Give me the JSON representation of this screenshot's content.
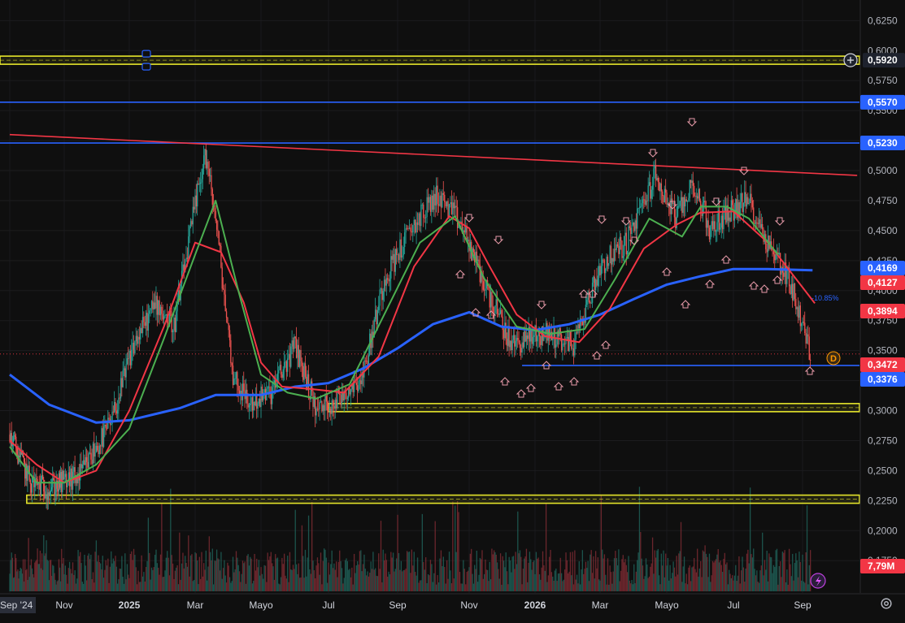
{
  "chart_data": {
    "type": "candlestick",
    "y_axis": {
      "ylim": [
        0.165,
        0.632
      ],
      "ticks": [
        "0,6250",
        "0,6000",
        "0,5750",
        "0,5500",
        "0,5250",
        "0,5000",
        "0,4750",
        "0,4500",
        "0,4250",
        "0,4000",
        "0,3750",
        "0,3500",
        "0,3250",
        "0,3000",
        "0,2750",
        "0,2500",
        "0,2250",
        "0,2000",
        "0,1750"
      ],
      "tick_values": [
        0.625,
        0.6,
        0.575,
        0.55,
        0.525,
        0.5,
        0.475,
        0.45,
        0.425,
        0.4,
        0.375,
        0.35,
        0.325,
        0.3,
        0.275,
        0.25,
        0.225,
        0.2,
        0.175
      ]
    },
    "x_axis": {
      "labels": [
        "Sep '24",
        "Nov",
        "2025",
        "Mar",
        "Mayo",
        "Jul",
        "Sep",
        "Nov",
        "2026",
        "Mar",
        "Mayo",
        "Jul",
        "Sep"
      ],
      "label_dates": [
        "2024-09-01",
        "2024-11-01",
        "2025-01-01",
        "2025-03-01",
        "2025-05-01",
        "2025-07-01",
        "2025-09-01",
        "2025-11-01",
        "2026-01-01",
        "2026-03-01",
        "2026-05-01",
        "2026-07-01",
        "2026-09-01"
      ]
    },
    "price_path": [
      [
        "2024-09-01",
        0.28
      ],
      [
        "2024-09-25",
        0.24
      ],
      [
        "2024-10-15",
        0.235
      ],
      [
        "2024-11-15",
        0.245
      ],
      [
        "2024-12-15",
        0.29
      ],
      [
        "2025-01-05",
        0.355
      ],
      [
        "2025-01-25",
        0.39
      ],
      [
        "2025-02-10",
        0.37
      ],
      [
        "2025-02-25",
        0.45
      ],
      [
        "2025-03-10",
        0.515
      ],
      [
        "2025-03-20",
        0.46
      ],
      [
        "2025-04-05",
        0.33
      ],
      [
        "2025-04-20",
        0.305
      ],
      [
        "2025-05-10",
        0.315
      ],
      [
        "2025-06-01",
        0.355
      ],
      [
        "2025-06-20",
        0.3
      ],
      [
        "2025-07-10",
        0.31
      ],
      [
        "2025-08-01",
        0.33
      ],
      [
        "2025-08-20",
        0.41
      ],
      [
        "2025-09-15",
        0.455
      ],
      [
        "2025-10-05",
        0.48
      ],
      [
        "2025-10-25",
        0.455
      ],
      [
        "2025-11-15",
        0.405
      ],
      [
        "2025-12-10",
        0.355
      ],
      [
        "2026-01-10",
        0.365
      ],
      [
        "2026-02-05",
        0.355
      ],
      [
        "2026-03-01",
        0.42
      ],
      [
        "2026-03-25",
        0.44
      ],
      [
        "2026-04-20",
        0.495
      ],
      [
        "2026-05-10",
        0.46
      ],
      [
        "2026-05-25",
        0.49
      ],
      [
        "2026-06-10",
        0.45
      ],
      [
        "2026-06-25",
        0.465
      ],
      [
        "2026-07-15",
        0.475
      ],
      [
        "2026-08-01",
        0.44
      ],
      [
        "2026-08-20",
        0.41
      ],
      [
        "2026-09-08",
        0.347
      ]
    ],
    "series": [
      {
        "name": "",
        "color": "#2962ff",
        "points": [
          [
            "2024-09-01",
            0.33
          ],
          [
            "2024-10-15",
            0.305
          ],
          [
            "2024-12-01",
            0.29
          ],
          [
            "2025-01-01",
            0.292
          ],
          [
            "2025-02-15",
            0.302
          ],
          [
            "2025-03-20",
            0.313
          ],
          [
            "2025-05-01",
            0.313
          ],
          [
            "2025-06-01",
            0.32
          ],
          [
            "2025-07-01",
            0.323
          ],
          [
            "2025-08-01",
            0.335
          ],
          [
            "2025-09-01",
            0.352
          ],
          [
            "2025-10-01",
            0.372
          ],
          [
            "2025-11-01",
            0.382
          ],
          [
            "2025-12-01",
            0.37
          ],
          [
            "2026-01-01",
            0.367
          ],
          [
            "2026-02-01",
            0.372
          ],
          [
            "2026-03-01",
            0.38
          ],
          [
            "2026-04-01",
            0.393
          ],
          [
            "2026-05-01",
            0.405
          ],
          [
            "2026-06-01",
            0.412
          ],
          [
            "2026-07-01",
            0.418
          ],
          [
            "2026-08-01",
            0.418
          ],
          [
            "2026-09-10",
            0.4169
          ]
        ]
      },
      {
        "name": "",
        "color": "#f23645",
        "points": [
          [
            "2024-09-01",
            0.275
          ],
          [
            "2024-10-01",
            0.255
          ],
          [
            "2024-11-01",
            0.24
          ],
          [
            "2024-12-01",
            0.25
          ],
          [
            "2025-01-01",
            0.3
          ],
          [
            "2025-02-01",
            0.37
          ],
          [
            "2025-03-01",
            0.44
          ],
          [
            "2025-03-25",
            0.432
          ],
          [
            "2025-04-15",
            0.39
          ],
          [
            "2025-05-01",
            0.34
          ],
          [
            "2025-05-20",
            0.32
          ],
          [
            "2025-06-15",
            0.318
          ],
          [
            "2025-07-15",
            0.315
          ],
          [
            "2025-08-15",
            0.345
          ],
          [
            "2025-09-15",
            0.42
          ],
          [
            "2025-10-15",
            0.462
          ],
          [
            "2025-11-01",
            0.452
          ],
          [
            "2025-11-20",
            0.42
          ],
          [
            "2025-12-15",
            0.38
          ],
          [
            "2026-01-10",
            0.362
          ],
          [
            "2026-02-10",
            0.357
          ],
          [
            "2026-03-10",
            0.385
          ],
          [
            "2026-04-10",
            0.435
          ],
          [
            "2026-05-10",
            0.455
          ],
          [
            "2026-06-01",
            0.465
          ],
          [
            "2026-07-01",
            0.466
          ],
          [
            "2026-08-01",
            0.44
          ],
          [
            "2026-09-12",
            0.3894
          ]
        ]
      },
      {
        "name": "",
        "color": "#4caf50",
        "points": [
          [
            "2024-09-01",
            0.27
          ],
          [
            "2024-10-01",
            0.24
          ],
          [
            "2024-11-01",
            0.24
          ],
          [
            "2024-12-01",
            0.255
          ],
          [
            "2025-01-01",
            0.285
          ],
          [
            "2025-02-01",
            0.36
          ],
          [
            "2025-03-01",
            0.43
          ],
          [
            "2025-03-20",
            0.475
          ],
          [
            "2025-04-10",
            0.4
          ],
          [
            "2025-05-01",
            0.33
          ],
          [
            "2025-05-25",
            0.315
          ],
          [
            "2025-06-20",
            0.31
          ],
          [
            "2025-07-20",
            0.322
          ],
          [
            "2025-08-20",
            0.38
          ],
          [
            "2025-09-20",
            0.44
          ],
          [
            "2025-10-20",
            0.462
          ],
          [
            "2025-11-15",
            0.41
          ],
          [
            "2025-12-15",
            0.37
          ],
          [
            "2026-01-15",
            0.364
          ],
          [
            "2026-02-15",
            0.368
          ],
          [
            "2026-03-15",
            0.41
          ],
          [
            "2026-04-15",
            0.46
          ],
          [
            "2026-05-15",
            0.445
          ],
          [
            "2026-06-01",
            0.47
          ],
          [
            "2026-06-25",
            0.47
          ],
          [
            "2026-07-15",
            0.46
          ],
          [
            "2026-08-10",
            0.43
          ]
        ]
      }
    ],
    "horizontal_levels": [
      {
        "value": 0.592,
        "label": "0,5920",
        "color": "#e5e52b",
        "style": "zone"
      },
      {
        "value": 0.557,
        "label": "0,5570",
        "color": "#2962ff",
        "style": "line"
      },
      {
        "value": 0.523,
        "label": "0,5230",
        "color": "#2962ff",
        "style": "line"
      },
      {
        "value": 0.3376,
        "label": "0,3376",
        "color": "#2962ff",
        "style": "line",
        "from": "2025-12-20"
      },
      {
        "value": 0.3025,
        "label": "",
        "color": "#e5e52b",
        "style": "zone",
        "from": "2025-07-01"
      },
      {
        "value": 0.2262,
        "label": "",
        "color": "#e5e52b",
        "style": "zone",
        "from": "2024-09-20"
      }
    ],
    "trendline": {
      "color": "#f23645",
      "from": [
        "2024-09-01",
        0.53
      ],
      "to": [
        "2026-10-20",
        0.496
      ]
    },
    "price_tags": [
      {
        "label": "0,4169",
        "color": "#2962ff",
        "value": 0.4169
      },
      {
        "label": "0,4127",
        "color": "#f23645",
        "value": 0.4127
      },
      {
        "label": "0,3894",
        "color": "#f23645",
        "value": 0.3894
      },
      {
        "label": "0,3472",
        "color": "#f23645",
        "value": 0.3472
      },
      {
        "label": "0,3376",
        "color": "#2962ff",
        "value": 0.3376
      }
    ],
    "volume_tag": {
      "label": "7,79M",
      "color": "#f23645"
    },
    "last_price_line": 0.3472,
    "percent_annotation": {
      "label": "-10.85%",
      "color": "#2962ff",
      "date": "2026-09-05",
      "value": 0.4
    }
  }
}
